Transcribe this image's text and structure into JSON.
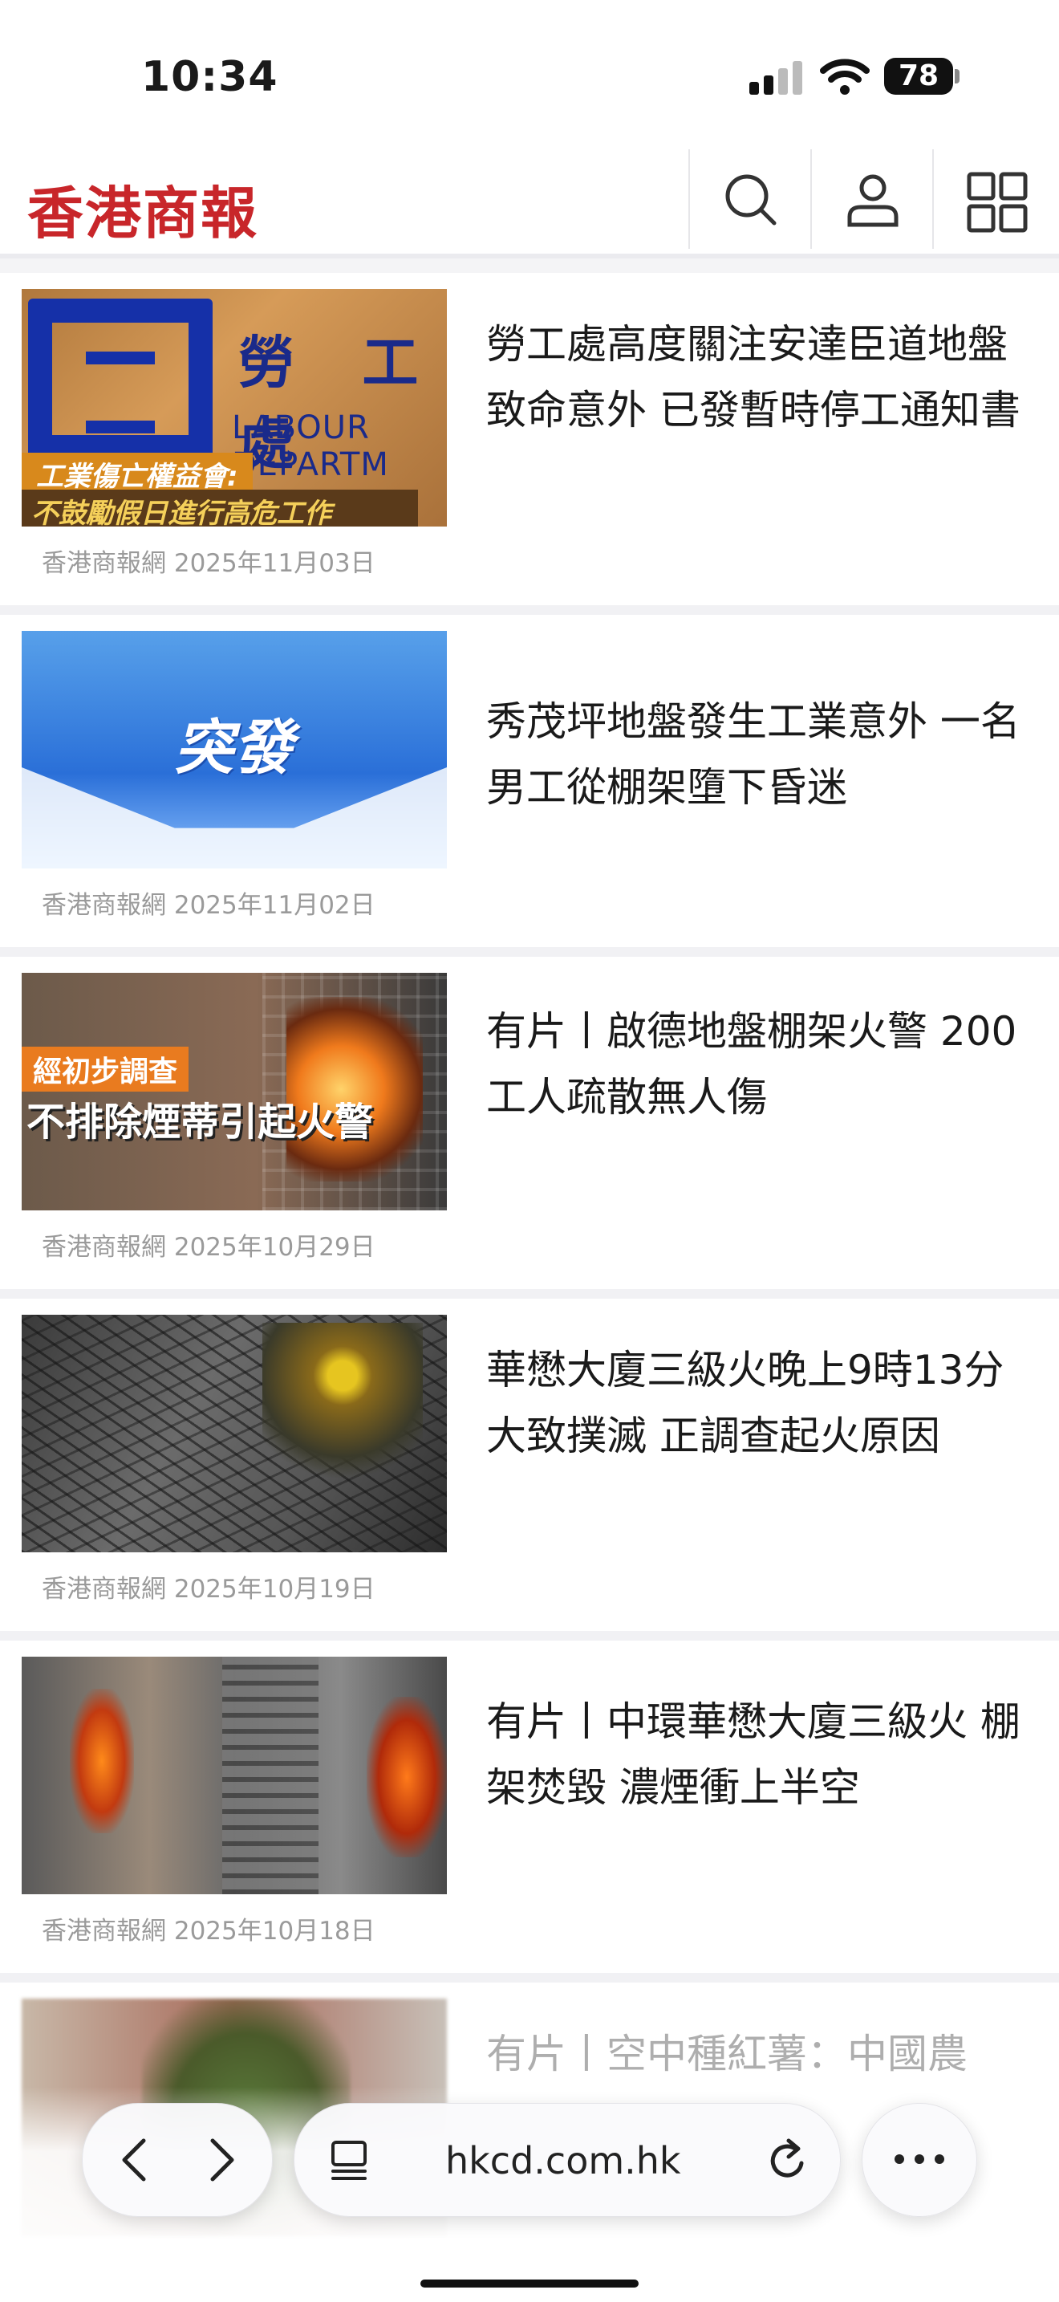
{
  "status_bar": {
    "time": "10:34",
    "battery": "78"
  },
  "header": {
    "logo": "香港商報"
  },
  "articles": [
    {
      "title": "勞工處高度關注安達臣道地盤致命意外 已發暫時停工通知書",
      "source_date": "香港商報網 2025年11月03日",
      "thumb_text": {
        "logo_caption": "勞 工 處",
        "logo_caption_en": "LABOUR DEPARTM",
        "caption_top": "工業傷亡權益會:",
        "caption_bottom": "不鼓勵假日進行高危工作"
      }
    },
    {
      "title": "秀茂坪地盤發生工業意外 一名男工從棚架墮下昏迷",
      "source_date": "香港商報網 2025年11月02日",
      "thumb_text": {
        "badge": "突發"
      }
    },
    {
      "title": "有片丨啟德地盤棚架火警 200工人疏散無人傷",
      "source_date": "香港商報網 2025年10月29日",
      "thumb_text": {
        "caption_top": "經初步調查",
        "caption_bottom": "不排除煙蒂引起火警"
      }
    },
    {
      "title": "華懋大廈三級火晚上9時13分大致撲滅 正調查起火原因",
      "source_date": "香港商報網 2025年10月19日"
    },
    {
      "title": "有片丨中環華懋大廈三級火 棚架焚毀 濃煙衝上半空",
      "source_date": "香港商報網 2025年10月18日"
    },
    {
      "title": "有片丨空中種紅薯：中國農",
      "source_date": ""
    }
  ],
  "browser": {
    "url": "hkcd.com.hk"
  }
}
